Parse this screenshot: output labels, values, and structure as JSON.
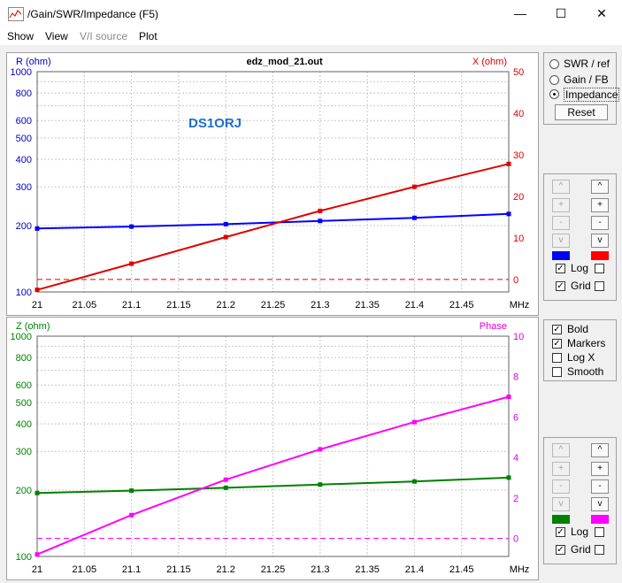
{
  "window": {
    "title": "/Gain/SWR/Impedance (F5)",
    "minimize": "—",
    "maximize": "☐",
    "close": "✕"
  },
  "menu": [
    "Show",
    "View",
    "V/I source",
    "Plot"
  ],
  "right_panel": {
    "radios": [
      "SWR / ref",
      "Gain / FB",
      "Impedance"
    ],
    "selected_radio": "Impedance",
    "reset_label": "Reset",
    "top_buttons": {
      "left": [
        "^",
        "+",
        "-",
        "v"
      ],
      "right": [
        "^",
        "+",
        "-",
        "v"
      ]
    },
    "top_swatches": [
      "#0000ff",
      "#ff0000"
    ],
    "top_checks": [
      {
        "label": "Log",
        "checked": true,
        "right_checked": false
      },
      {
        "label": "Grid",
        "checked": true,
        "right_checked": false
      }
    ],
    "options": [
      {
        "label": "Bold",
        "checked": true
      },
      {
        "label": "Markers",
        "checked": true
      },
      {
        "label": "Log X",
        "checked": false
      },
      {
        "label": "Smooth",
        "checked": false
      }
    ],
    "bottom_buttons": {
      "left": [
        "^",
        "+",
        "-",
        "v"
      ],
      "right": [
        "^",
        "+",
        "-",
        "v"
      ]
    },
    "bottom_swatches": [
      "#008000",
      "#ff00ff"
    ],
    "bottom_checks": [
      {
        "label": "Log",
        "checked": true,
        "right_checked": false
      },
      {
        "label": "Grid",
        "checked": true,
        "right_checked": false
      }
    ]
  },
  "chart_data": [
    {
      "type": "line",
      "title": "edz_mod_21.out",
      "annotation": "DS1ORJ",
      "x_unit": "MHz",
      "x_ticks": [
        "21",
        "21.05",
        "21.1",
        "21.15",
        "21.2",
        "21.25",
        "21.3",
        "21.35",
        "21.4",
        "21.45"
      ],
      "xlim": [
        21.0,
        21.5
      ],
      "left_axis": {
        "label": "R (ohm)",
        "scale": "log",
        "ylim": [
          100,
          1000
        ],
        "ticks": [
          "100",
          "200",
          "300",
          "400",
          "500",
          "600",
          "800",
          "1000"
        ],
        "color": "#0000c0"
      },
      "right_axis": {
        "label": "X (ohm)",
        "scale": "linear",
        "ylim": [
          -3,
          50
        ],
        "ticks": [
          "0",
          "10",
          "20",
          "30",
          "40",
          "50"
        ],
        "color": "#e00000"
      },
      "series": [
        {
          "axis": "left",
          "color": "#0000ff",
          "x": [
            21.0,
            21.1,
            21.2,
            21.3,
            21.4,
            21.5
          ],
          "y": [
            194,
            198,
            203,
            210,
            217,
            226
          ]
        },
        {
          "axis": "right",
          "color": "#e00000",
          "x": [
            21.0,
            21.1,
            21.2,
            21.3,
            21.4,
            21.5
          ],
          "y": [
            -2.5,
            3.8,
            10.2,
            16.5,
            22.3,
            27.8
          ]
        }
      ],
      "zero_line_axis": "right",
      "grid": true
    },
    {
      "type": "line",
      "title": "",
      "x_unit": "MHz",
      "x_ticks": [
        "21",
        "21.05",
        "21.1",
        "21.15",
        "21.2",
        "21.25",
        "21.3",
        "21.35",
        "21.4",
        "21.45"
      ],
      "xlim": [
        21.0,
        21.5
      ],
      "left_axis": {
        "label": "Z (ohm)",
        "scale": "log",
        "ylim": [
          100,
          1000
        ],
        "ticks": [
          "100",
          "200",
          "300",
          "400",
          "500",
          "600",
          "800",
          "1000"
        ],
        "color": "#008000"
      },
      "right_axis": {
        "label": "Phase",
        "scale": "linear",
        "ylim": [
          -0.9,
          10
        ],
        "ticks": [
          "0",
          "2",
          "4",
          "6",
          "8",
          "10"
        ],
        "color": "#e000e0"
      },
      "series": [
        {
          "axis": "left",
          "color": "#008000",
          "x": [
            21.0,
            21.1,
            21.2,
            21.3,
            21.4,
            21.5
          ],
          "y": [
            194,
            199,
            205,
            212,
            219,
            228
          ]
        },
        {
          "axis": "right",
          "color": "#ff00ff",
          "x": [
            21.0,
            21.1,
            21.2,
            21.3,
            21.4,
            21.5
          ],
          "y": [
            -0.8,
            1.15,
            2.9,
            4.4,
            5.75,
            7.0
          ]
        }
      ],
      "zero_line_axis": "right",
      "grid": true
    }
  ]
}
